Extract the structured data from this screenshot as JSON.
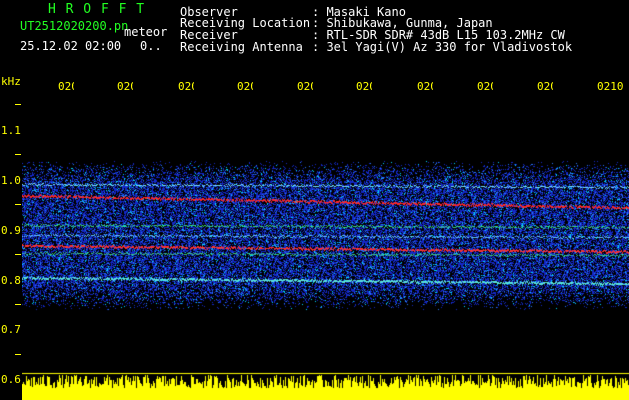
{
  "header": {
    "logo": "H R O F F T",
    "filename": "UT2512020200.pn",
    "meteor_label": "meteor",
    "datetime": "25.12.02 02:00",
    "count": "0..",
    "observer_label": "Observer",
    "observer_value": ": Masaki Kano",
    "location_label": "Receiving Location",
    "location_value": ": Shibukawa, Gunma, Japan",
    "receiver_label": "Receiver",
    "receiver_value": ": RTL-SDR SDR# 43dB L15 103.2MHz CW",
    "antenna_label": "Receiving Antenna",
    "antenna_value": ": 3el Yagi(V) Az 330 for Vladivostok"
  },
  "axis": {
    "unit": "kHz",
    "time_ticks": [
      "0201",
      "0202",
      "0203",
      "0204",
      "0205",
      "0206",
      "0207",
      "0208",
      "0209",
      "0210"
    ],
    "freq_ticks": [
      "1.1",
      "1.0",
      "0.9",
      "0.8",
      "0.7",
      "0.6"
    ]
  },
  "colors": {
    "text_green": "#22ff22",
    "text_white": "#ffffff",
    "axis_yellow": "#ffff00",
    "noise_blue": "#1a3cff",
    "signal_red": "#ff2020",
    "background": "#000000"
  }
}
